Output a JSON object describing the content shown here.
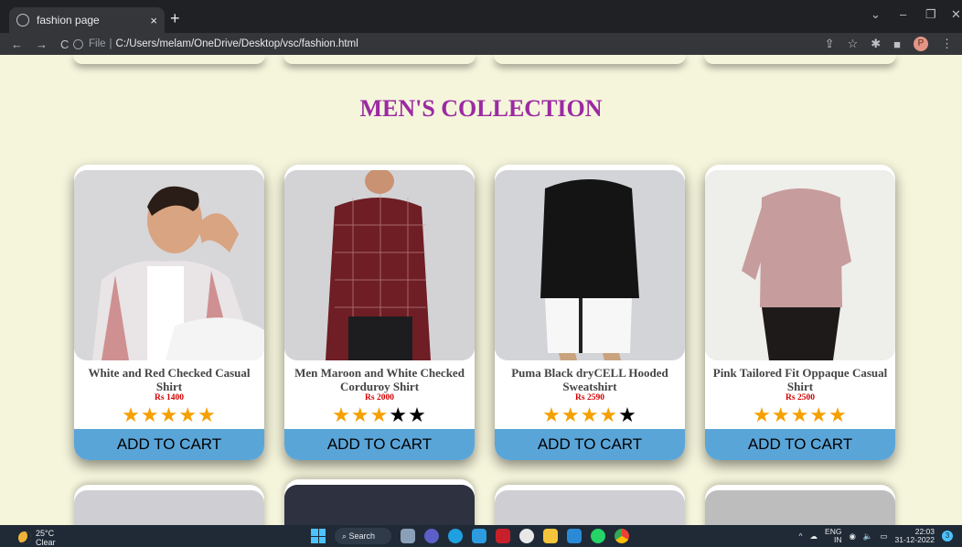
{
  "browser": {
    "tab_title": "fashion page",
    "tab_close": "×",
    "new_tab": "+",
    "url_prefix": "File",
    "url": "C:/Users/melam/OneDrive/Desktop/vsc/fashion.html",
    "profile_initial": "P"
  },
  "page": {
    "section_title": "MEN'S COLLECTION",
    "products": [
      {
        "name": "White and Red Checked Casual Shirt",
        "price": "Rs 1400",
        "rating": 5,
        "button": "ADD TO CART"
      },
      {
        "name": "Men Maroon and White Checked Corduroy Shirt",
        "price": "Rs 2000",
        "rating": 3,
        "button": "ADD TO CART"
      },
      {
        "name": "Puma Black dryCELL Hooded Sweatshirt",
        "price": "Rs 2590",
        "rating": 4,
        "button": "ADD TO CART"
      },
      {
        "name": "Pink Tailored Fit Oppaque Casual Shirt",
        "price": "Rs 2500",
        "rating": 5,
        "button": "ADD TO CART"
      }
    ]
  },
  "taskbar": {
    "temperature": "25°C",
    "condition": "Clear",
    "search_label": "Search",
    "lang_top": "ENG",
    "lang_bottom": "IN",
    "time": "22:03",
    "date": "31-12-2022",
    "notification_count": "3"
  },
  "colors": {
    "page_bg": "#f5f5dc",
    "title": "#9b2aa2",
    "price": "#d40000",
    "star": "#f5a000",
    "cart_button": "#5aa5d8"
  }
}
